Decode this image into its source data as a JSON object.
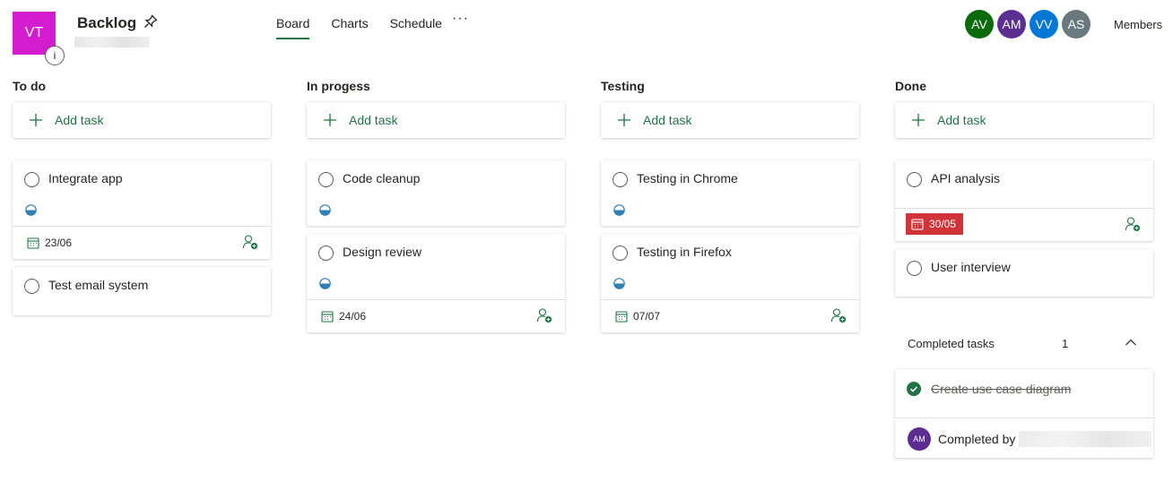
{
  "header": {
    "plan_initials": "VT",
    "info_label": "i",
    "title": "Backlog",
    "nav_tabs": [
      "Board",
      "Charts",
      "Schedule"
    ],
    "more_label": "···",
    "members": [
      {
        "initials": "AV",
        "color": "#0b6a0b"
      },
      {
        "initials": "AM",
        "color": "#5c2e91"
      },
      {
        "initials": "VV",
        "color": "#0078d4"
      },
      {
        "initials": "AS",
        "color": "#69797e"
      }
    ],
    "members_label": "Members"
  },
  "columns": [
    {
      "title": "To do",
      "add_label": "Add task"
    },
    {
      "title": "In progess",
      "add_label": "Add task"
    },
    {
      "title": "Testing",
      "add_label": "Add task"
    },
    {
      "title": "Done",
      "add_label": "Add task"
    }
  ],
  "tasks": {
    "integrate_app": {
      "title": "Integrate app",
      "date": "23/06"
    },
    "test_email": {
      "title": "Test email system"
    },
    "code_cleanup": {
      "title": "Code cleanup"
    },
    "design_review": {
      "title": "Design review",
      "date": "24/06"
    },
    "testing_chrome": {
      "title": "Testing in Chrome"
    },
    "testing_firefox": {
      "title": "Testing in Firefox",
      "date": "07/07"
    },
    "api_analysis": {
      "title": "API analysis",
      "date": "30/05",
      "overdue_color": "#d13438"
    },
    "user_interview": {
      "title": "User interview"
    }
  },
  "completed": {
    "label": "Completed tasks",
    "count": "1",
    "task_title": "Create use case diagram",
    "completed_by_initials": "AM",
    "completed_by_label": "Completed by"
  },
  "colors": {
    "accent": "#217346",
    "progress_blue": "#2f7fb4"
  }
}
